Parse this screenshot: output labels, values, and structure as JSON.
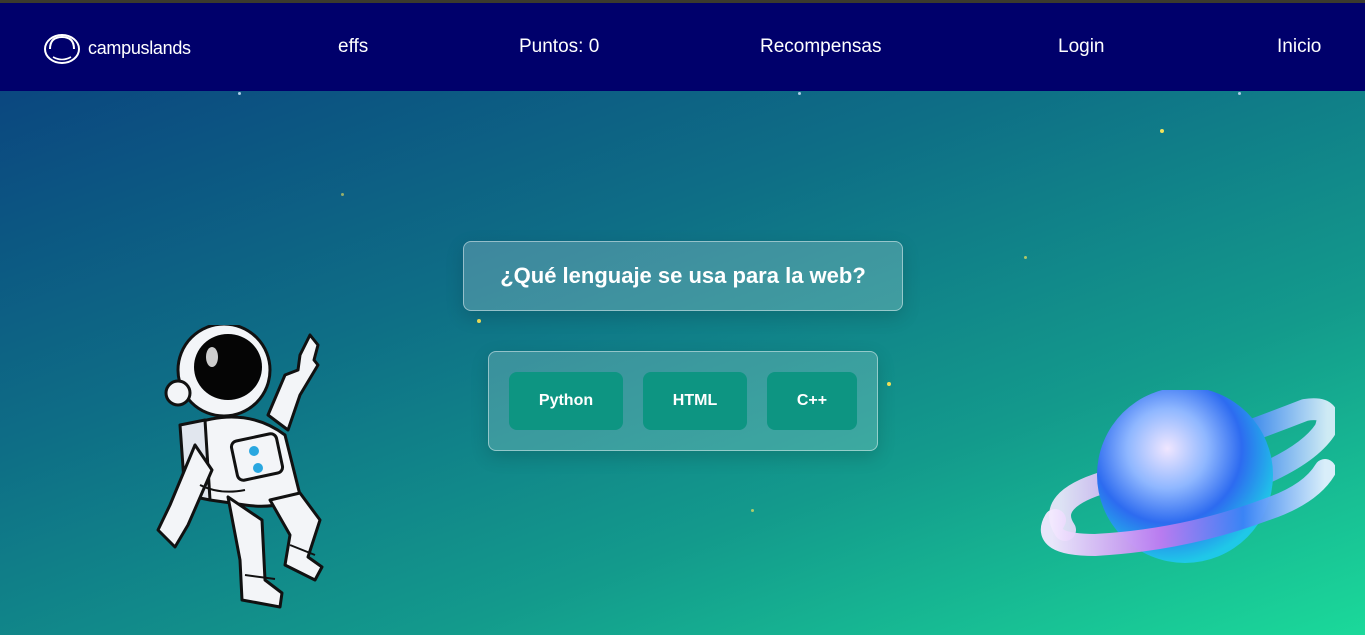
{
  "navbar": {
    "logo_text": "campuslands",
    "links": [
      "effs",
      "Puntos: 0",
      "Recompensas",
      "Login",
      "Inicio"
    ]
  },
  "quiz": {
    "question": "¿Qué lenguaje se usa para la web?",
    "options": [
      "Python",
      "HTML",
      "C++"
    ]
  },
  "colors": {
    "navbar_bg": "#00006b",
    "option_bg": "#0d9582",
    "gradient_start": "#0a3d7e",
    "gradient_end": "#1bd99a"
  },
  "icons": [
    "astronaut-helmet-logo-icon",
    "astronaut-illustration",
    "planet-illustration"
  ]
}
